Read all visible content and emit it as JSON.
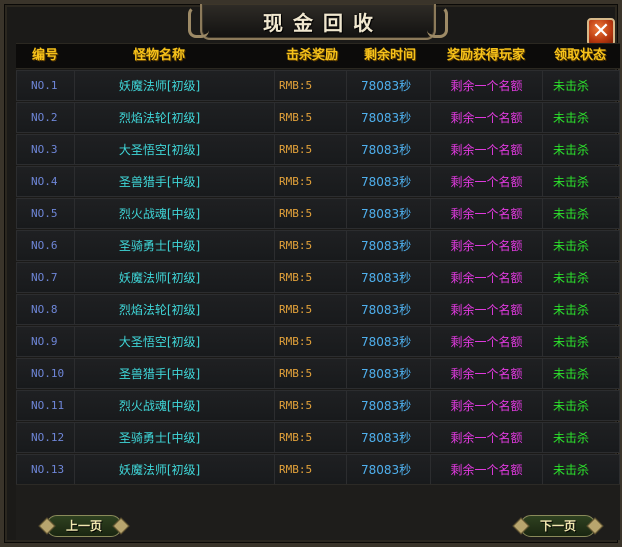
{
  "window": {
    "title": "现金回收",
    "close_label": "✕"
  },
  "table": {
    "headers": [
      "编号",
      "怪物名称",
      "击杀奖励",
      "剩余时间",
      "奖励获得玩家",
      "领取状态"
    ],
    "rows": [
      {
        "no": "NO.1",
        "name": "妖魔法师[初级]",
        "reward": "RMB:5",
        "time": "78083秒",
        "winner": "剩余一个名额",
        "status": "未击杀"
      },
      {
        "no": "NO.2",
        "name": "烈焰法轮[初级]",
        "reward": "RMB:5",
        "time": "78083秒",
        "winner": "剩余一个名额",
        "status": "未击杀"
      },
      {
        "no": "NO.3",
        "name": "大圣悟空[初级]",
        "reward": "RMB:5",
        "time": "78083秒",
        "winner": "剩余一个名额",
        "status": "未击杀"
      },
      {
        "no": "NO.4",
        "name": "圣兽猎手[中级]",
        "reward": "RMB:5",
        "time": "78083秒",
        "winner": "剩余一个名额",
        "status": "未击杀"
      },
      {
        "no": "NO.5",
        "name": "烈火战魂[中级]",
        "reward": "RMB:5",
        "time": "78083秒",
        "winner": "剩余一个名额",
        "status": "未击杀"
      },
      {
        "no": "NO.6",
        "name": "圣骑勇士[中级]",
        "reward": "RMB:5",
        "time": "78083秒",
        "winner": "剩余一个名额",
        "status": "未击杀"
      },
      {
        "no": "NO.7",
        "name": "妖魔法师[初级]",
        "reward": "RMB:5",
        "time": "78083秒",
        "winner": "剩余一个名额",
        "status": "未击杀"
      },
      {
        "no": "NO.8",
        "name": "烈焰法轮[初级]",
        "reward": "RMB:5",
        "time": "78083秒",
        "winner": "剩余一个名额",
        "status": "未击杀"
      },
      {
        "no": "NO.9",
        "name": "大圣悟空[初级]",
        "reward": "RMB:5",
        "time": "78083秒",
        "winner": "剩余一个名额",
        "status": "未击杀"
      },
      {
        "no": "NO.10",
        "name": "圣兽猎手[中级]",
        "reward": "RMB:5",
        "time": "78083秒",
        "winner": "剩余一个名额",
        "status": "未击杀"
      },
      {
        "no": "NO.11",
        "name": "烈火战魂[中级]",
        "reward": "RMB:5",
        "time": "78083秒",
        "winner": "剩余一个名额",
        "status": "未击杀"
      },
      {
        "no": "NO.12",
        "name": "圣骑勇士[中级]",
        "reward": "RMB:5",
        "time": "78083秒",
        "winner": "剩余一个名额",
        "status": "未击杀"
      },
      {
        "no": "NO.13",
        "name": "妖魔法师[初级]",
        "reward": "RMB:5",
        "time": "78083秒",
        "winner": "剩余一个名额",
        "status": "未击杀"
      }
    ]
  },
  "footer": {
    "prev_label": "上一页",
    "next_label": "下一页"
  },
  "colors": {
    "header_text": "#f6c21a",
    "number_text": "#6e86d8",
    "name_text": "#3fd6d8",
    "reward_text": "#e3a23a",
    "time_text": "#4fb0ee",
    "winner_text": "#e23ae0",
    "status_text": "#2ce32c",
    "close_button": "#c8461a"
  },
  "icons": {
    "close": "close-icon",
    "title_ornament": "scroll-ornament-icon",
    "page_button_ornament": "diamond-ornament-icon"
  }
}
